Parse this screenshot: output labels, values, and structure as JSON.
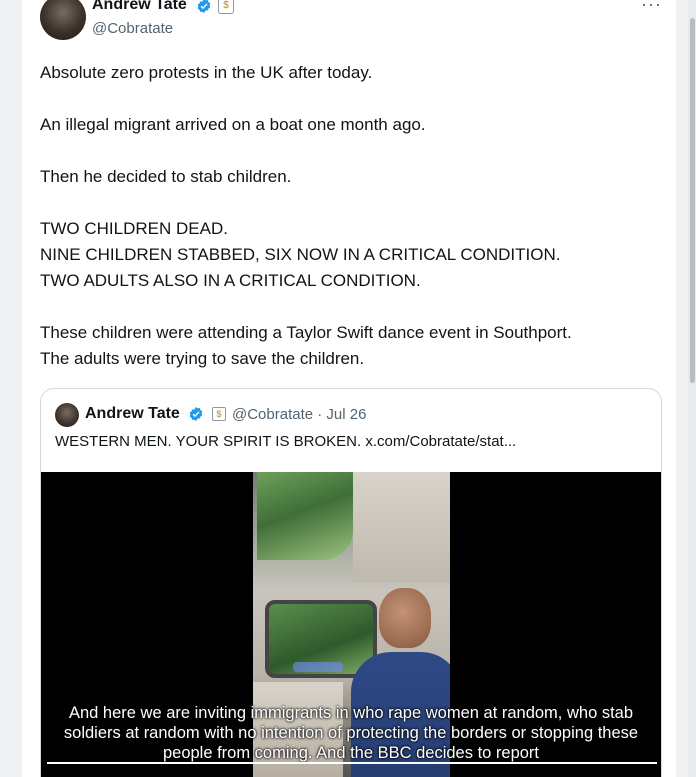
{
  "post": {
    "author_name": "Andrew Tate",
    "author_handle": "@Cobratate",
    "more_label": "···",
    "affiliate_badge": "$",
    "text_lines": [
      "Absolute zero protests in the UK after today.",
      "",
      "An illegal migrant arrived on a boat one month ago.",
      "",
      "Then he decided to stab children.",
      "",
      "TWO CHILDREN DEAD.",
      "NINE CHILDREN STABBED, SIX NOW IN A CRITICAL CONDITION.",
      "TWO ADULTS ALSO IN A CRITICAL CONDITION.",
      "",
      "These children were attending a Taylor Swift dance event in Southport.",
      "The adults were trying to save the children."
    ]
  },
  "quote": {
    "author_name": "Andrew Tate",
    "affiliate_badge": "$",
    "meta": "@Cobratate · Jul 26",
    "text": "WESTERN MEN. YOUR SPIRIT IS BROKEN.  x.com/Cobratate/stat...",
    "video_caption_lines": [
      "And here we are inviting immigrants in who rape women at random, who stab",
      "soldiers at random with no intention of protecting the borders or stopping these",
      "people from coming. And the BBC decides to report"
    ]
  },
  "icons": {
    "verified": "verified-badge-icon",
    "affiliate": "affiliate-badge-icon",
    "more": "more-options-icon"
  },
  "colors": {
    "verified_blue": "#1d9bf0",
    "secondary_text": "#536471",
    "border": "#cfd9de"
  }
}
